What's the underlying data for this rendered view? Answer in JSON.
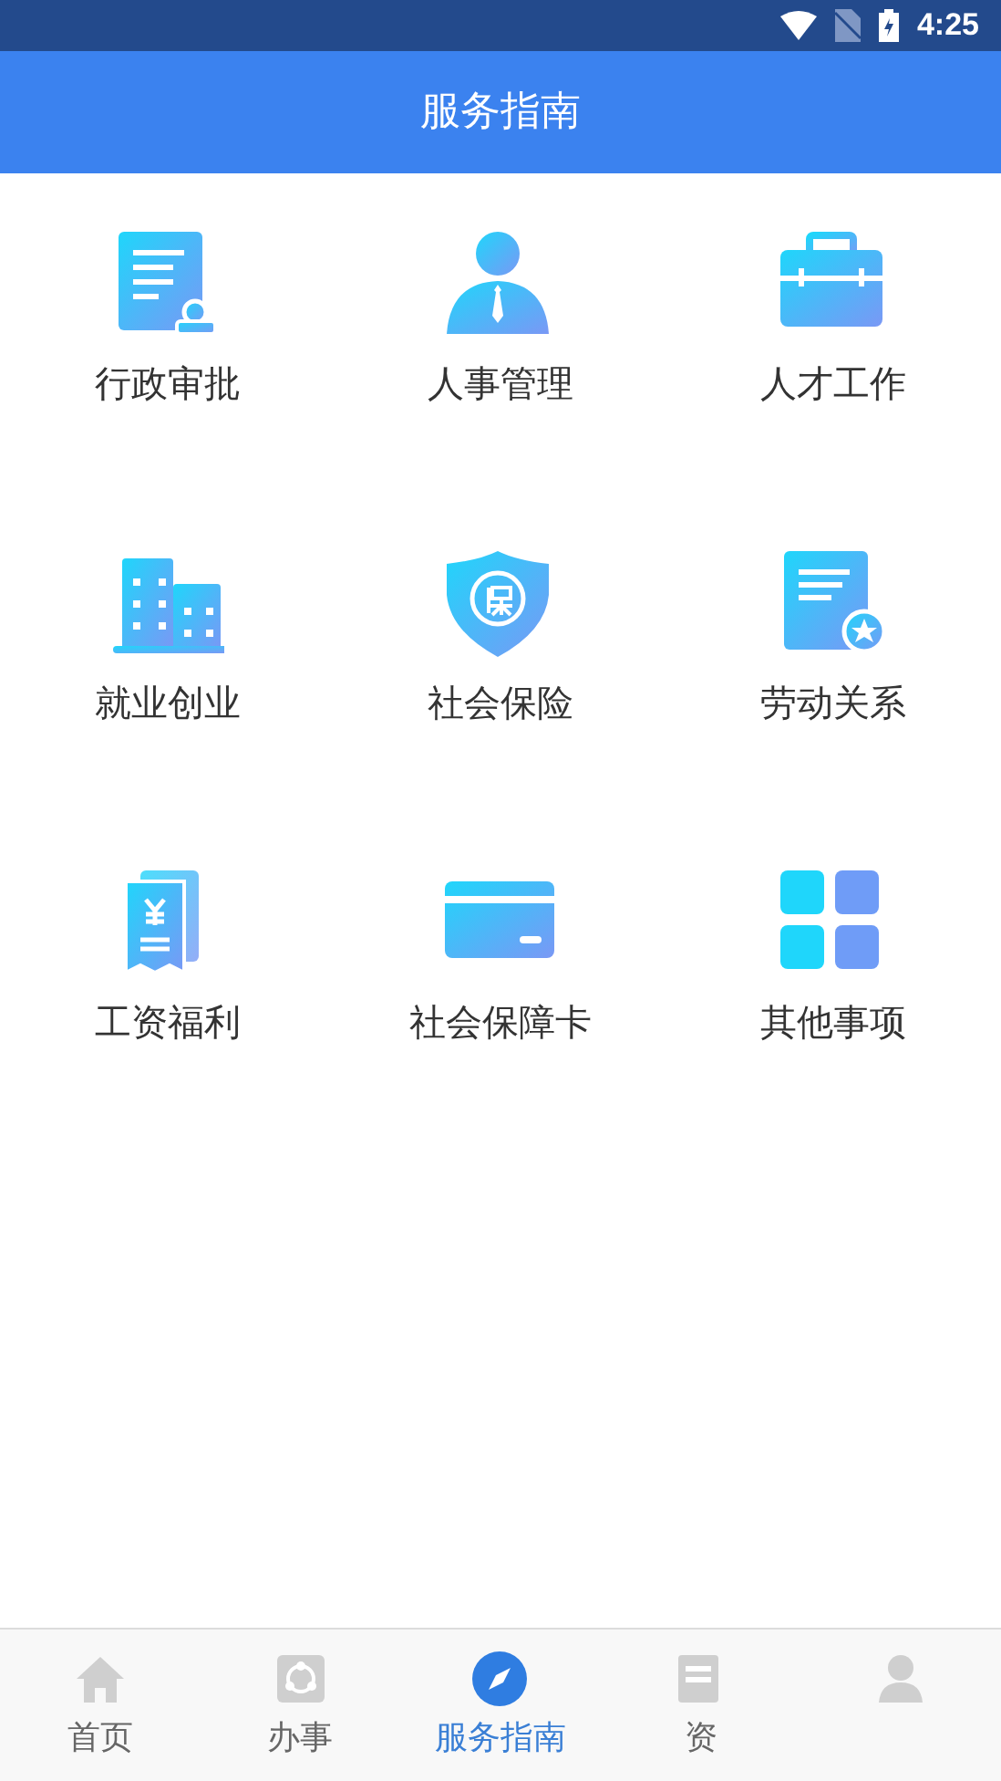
{
  "status_bar": {
    "time": "4:25"
  },
  "header": {
    "title": "服务指南"
  },
  "services": [
    {
      "label": "行政审批"
    },
    {
      "label": "人事管理"
    },
    {
      "label": "人才工作"
    },
    {
      "label": "就业创业"
    },
    {
      "label": "社会保险"
    },
    {
      "label": "劳动关系"
    },
    {
      "label": "工资福利"
    },
    {
      "label": "社会保障卡"
    },
    {
      "label": "其他事项"
    }
  ],
  "tabs": [
    {
      "label": "首页",
      "selected": false
    },
    {
      "label": "办事",
      "selected": false
    },
    {
      "label": "服务指南",
      "selected": true
    },
    {
      "label": "资",
      "selected": false
    },
    {
      "selected": false
    }
  ]
}
